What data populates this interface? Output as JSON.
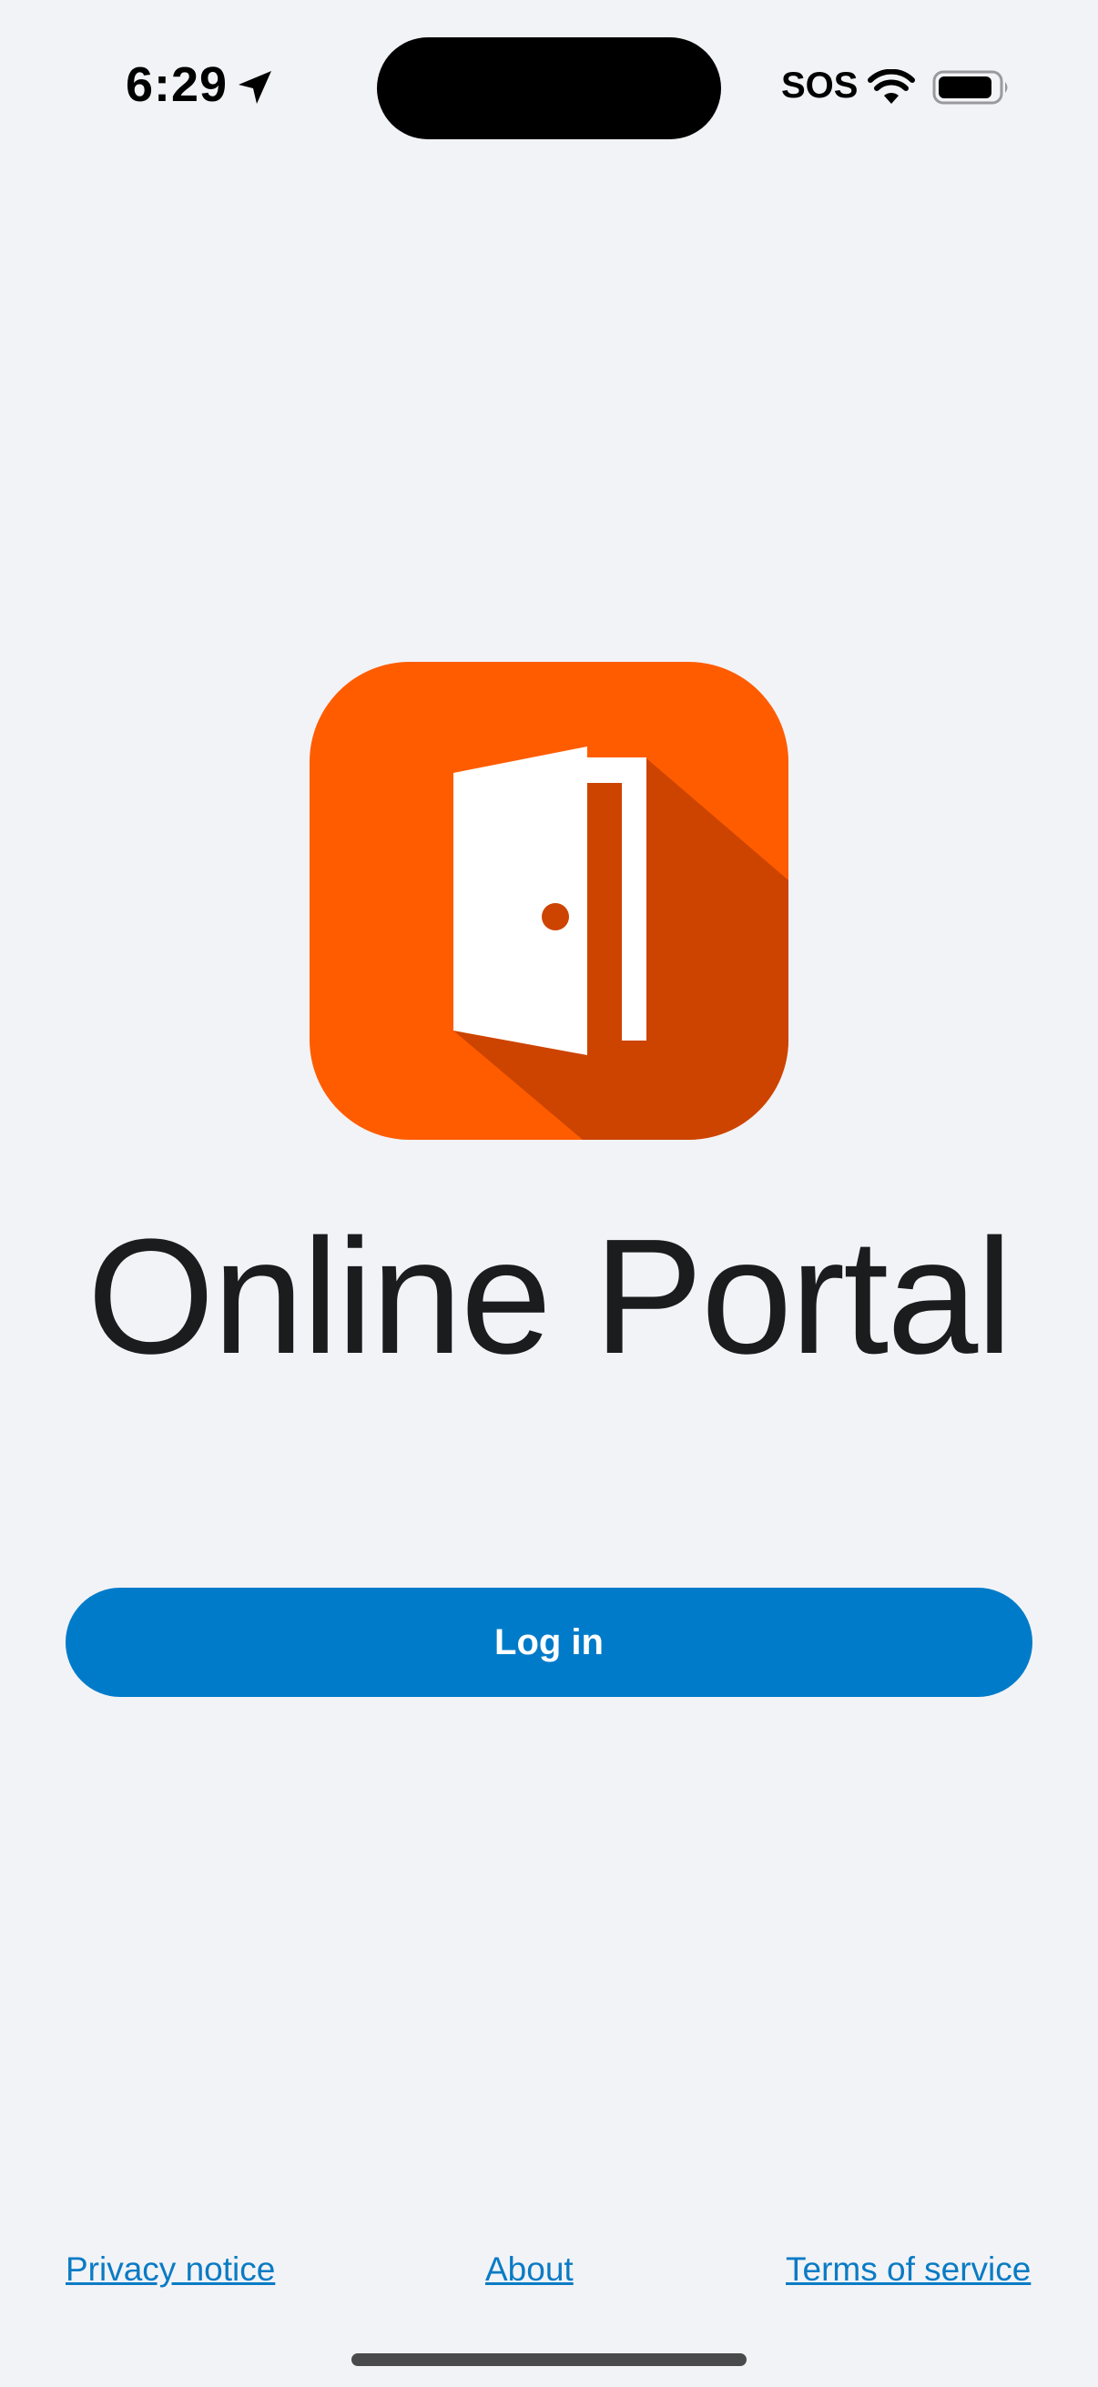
{
  "status_bar": {
    "time": "6:29",
    "carrier_status": "SOS",
    "icons": [
      "location-arrow-icon",
      "wifi-icon",
      "battery-icon"
    ]
  },
  "app": {
    "icon": "open-door-icon",
    "title": "Online Portal",
    "colors": {
      "icon_background": "#FF5C00",
      "icon_shadow": "#CC4400",
      "primary_button": "#007BC9",
      "link": "#0A7BC4",
      "page_background": "#F2F3F7"
    }
  },
  "actions": {
    "login_label": "Log in"
  },
  "footer": {
    "privacy": "Privacy notice",
    "about": "About",
    "terms": "Terms of service"
  }
}
